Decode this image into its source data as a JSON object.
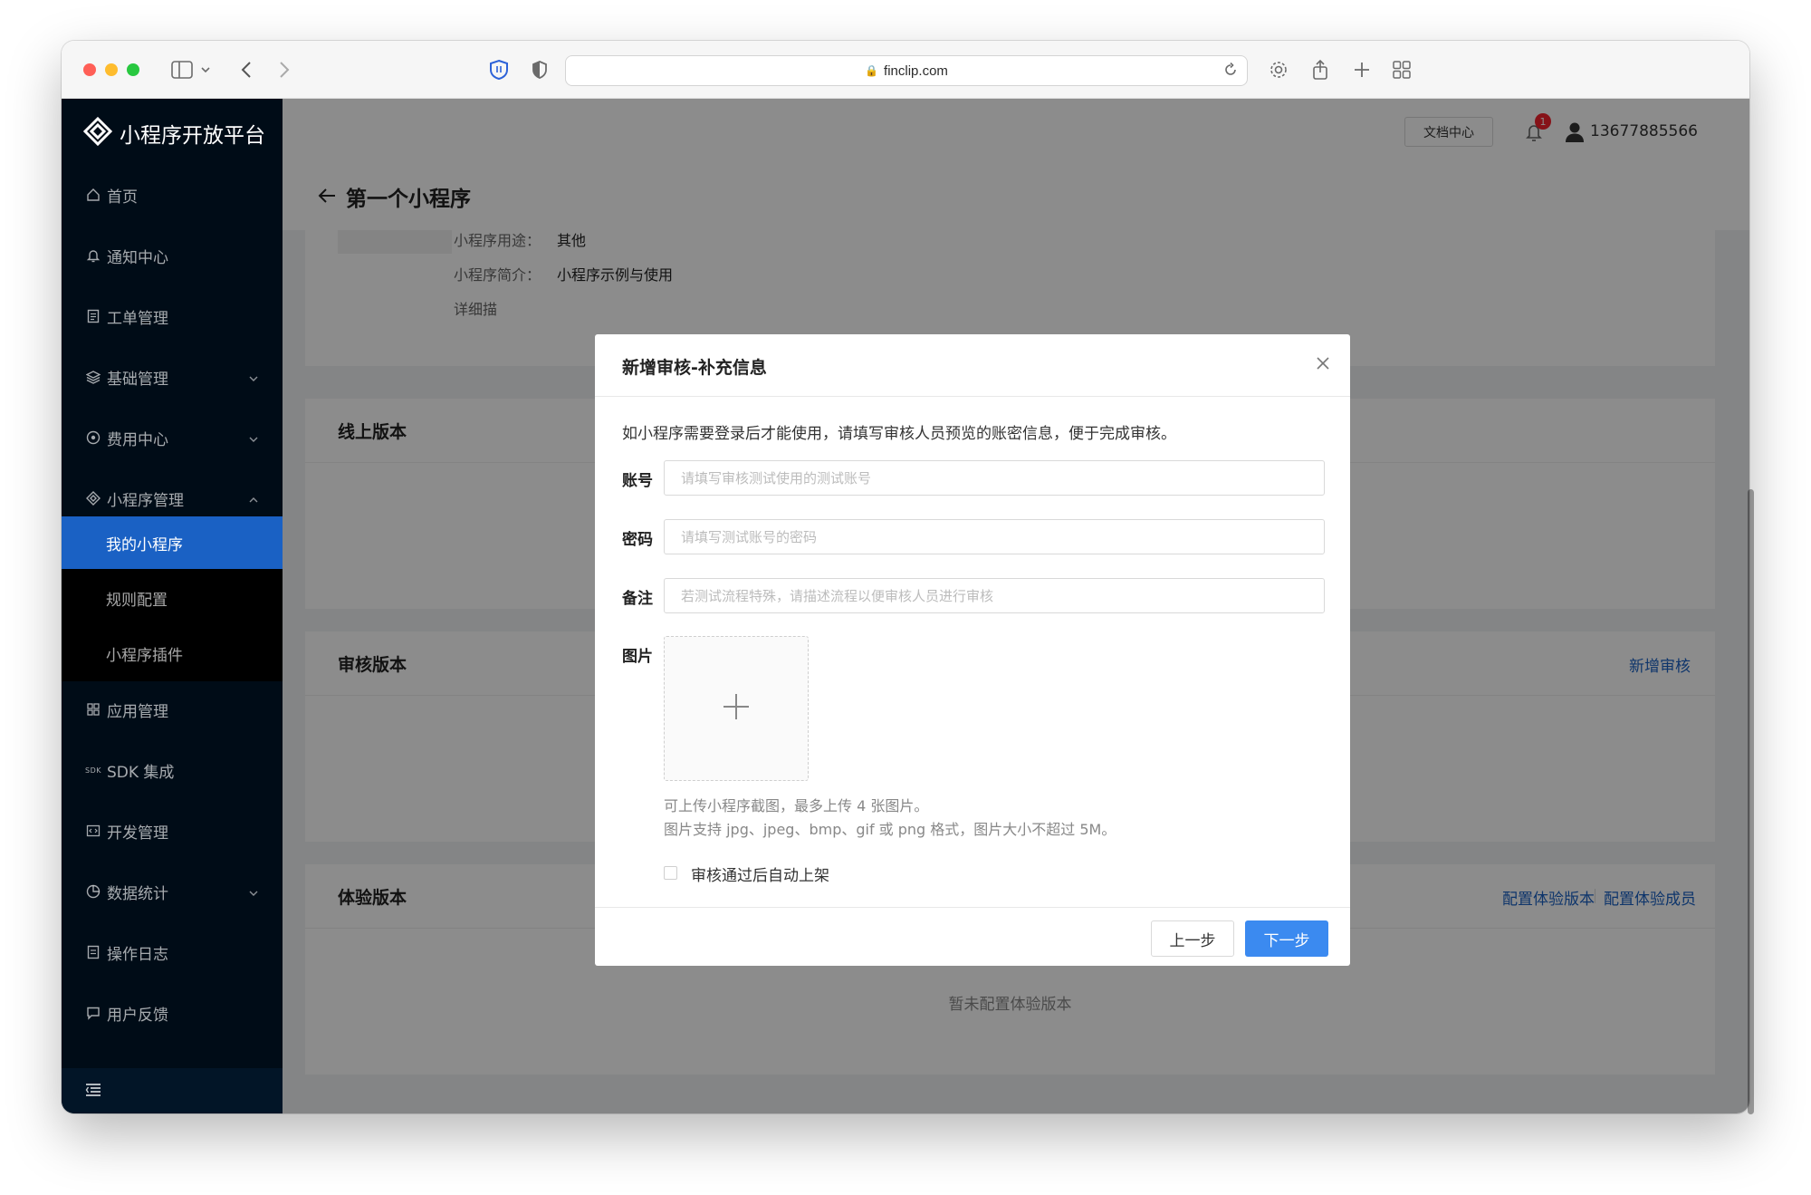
{
  "browser": {
    "url": "finclip.com"
  },
  "sidebar": {
    "logo": "小程序开放平台",
    "items": [
      {
        "label": "首页",
        "icon": "home-icon"
      },
      {
        "label": "通知中心",
        "icon": "bell-icon"
      },
      {
        "label": "工单管理",
        "icon": "ticket-icon"
      },
      {
        "label": "基础管理",
        "icon": "layers-icon"
      },
      {
        "label": "费用中心",
        "icon": "coin-icon"
      },
      {
        "label": "小程序管理",
        "icon": "diamond-icon"
      },
      {
        "label": "应用管理",
        "icon": "grid-icon"
      },
      {
        "label": "SDK 集成",
        "icon": "sdk-icon"
      },
      {
        "label": "开发管理",
        "icon": "code-icon"
      },
      {
        "label": "数据统计",
        "icon": "pie-icon"
      },
      {
        "label": "操作日志",
        "icon": "log-icon"
      },
      {
        "label": "用户反馈",
        "icon": "message-icon"
      }
    ],
    "subitems": [
      {
        "label": "我的小程序",
        "active": true
      },
      {
        "label": "规则配置",
        "active": false
      },
      {
        "label": "小程序插件",
        "active": false
      }
    ]
  },
  "header": {
    "doc_button": "文档中心",
    "notifications": "1",
    "user_phone": "13677885566"
  },
  "page": {
    "title": "第一个小程序",
    "info": {
      "usage_label": "小程序用途：",
      "usage_value": "其他",
      "intro_label": "小程序简介：",
      "intro_value": "小程序示例与使用",
      "detail_label": "详细描"
    },
    "sections": {
      "online": "线上版本",
      "review": "审核版本",
      "review_link": "新增审核",
      "trial": "体验版本",
      "trial_link_1": "配置体验版本",
      "trial_link_2": "配置体验成员",
      "trial_empty": "暂未配置体验版本"
    }
  },
  "modal": {
    "title": "新增审核-补充信息",
    "description": "如小程序需要登录后才能使用，请填写审核人员预览的账密信息，便于完成审核。",
    "fields": {
      "account_label": "账号",
      "account_placeholder": "请填写审核测试使用的测试账号",
      "password_label": "密码",
      "password_placeholder": "请填写测试账号的密码",
      "remark_label": "备注",
      "remark_placeholder": "若测试流程特殊，请描述流程以便审核人员进行审核",
      "image_label": "图片"
    },
    "upload_tip_1": "可上传小程序截图，最多上传 4 张图片。",
    "upload_tip_2": "图片支持 jpg、jpeg、bmp、gif 或 png 格式，图片大小不超过 5M。",
    "auto_publish_label": "审核通过后自动上架",
    "prev_button": "上一步",
    "next_button": "下一步"
  },
  "colors": {
    "sidebar_bg": "#000c17",
    "active_item": "#1a61c4",
    "primary_button": "#3b8af0",
    "link": "#1a61c4"
  }
}
